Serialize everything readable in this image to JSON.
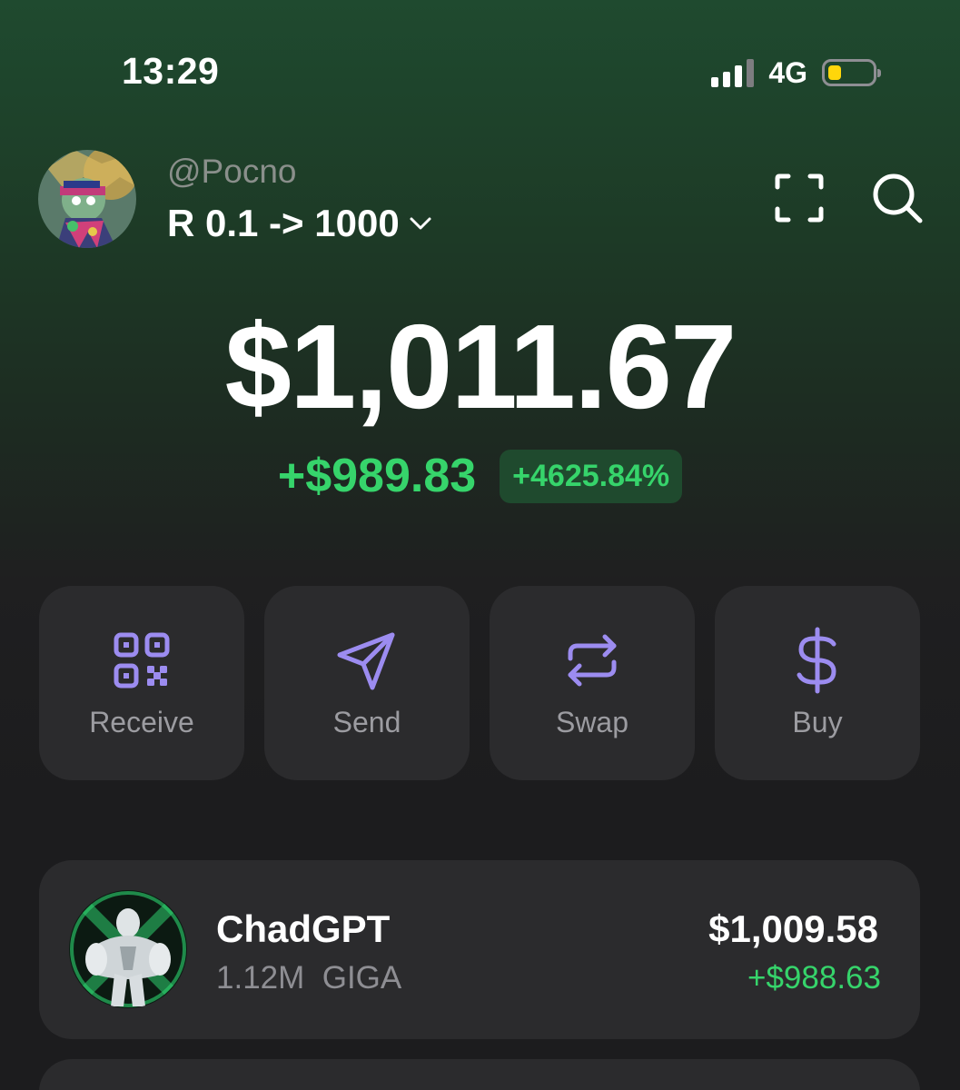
{
  "status_bar": {
    "time": "13:29",
    "network": "4G",
    "battery_level": 0.3,
    "battery_color": "#ffd60a"
  },
  "header": {
    "username": "@Pocno",
    "wallet_name": "R 0.1 -> 1000",
    "icons": {
      "avatar": "profile-avatar",
      "selector": "chevron-down-icon",
      "scan": "scan-icon",
      "search": "search-icon"
    }
  },
  "balance": {
    "total": "$1,011.67",
    "change_amount": "+$989.83",
    "change_percent": "+4625.84%",
    "positive_color": "#36d46b"
  },
  "actions": [
    {
      "label": "Receive",
      "icon": "qr-code-icon"
    },
    {
      "label": "Send",
      "icon": "send-icon"
    },
    {
      "label": "Swap",
      "icon": "swap-icon"
    },
    {
      "label": "Buy",
      "icon": "dollar-icon"
    }
  ],
  "accent_color": "#9c8cf0",
  "tokens": [
    {
      "name": "ChadGPT",
      "amount": "1.12M",
      "symbol": "GIGA",
      "value": "$1,009.58",
      "pnl": "+$988.63"
    }
  ]
}
